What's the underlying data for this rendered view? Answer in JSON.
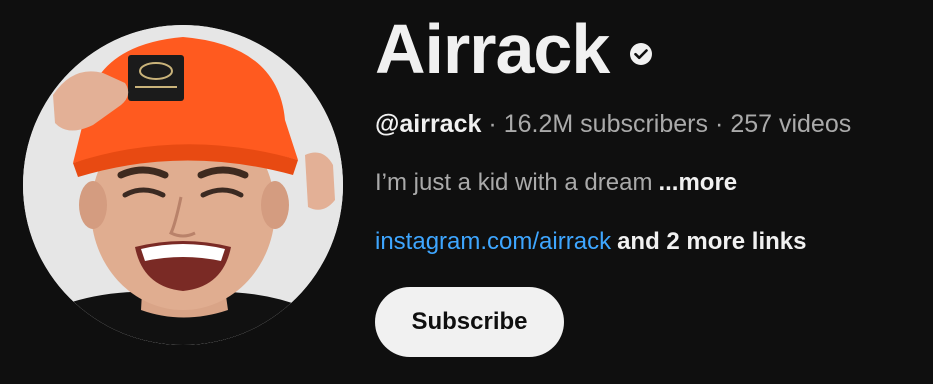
{
  "channel": {
    "name": "Airrack",
    "handle": "@airrack",
    "separator": "·",
    "subscribers": "16.2M subscribers",
    "videos": "257 videos",
    "description": "I’m just a kid with a dream",
    "description_more": "...more",
    "link": "instagram.com/airrack",
    "more_links": "and 2 more links",
    "subscribe_label": "Subscribe",
    "avatar_icon": "channel-avatar-photo",
    "verified_icon": "verified-check-icon"
  },
  "colors": {
    "background": "#0f0f0f",
    "primary_text": "#f1f1f1",
    "secondary_text": "#aaaaaa",
    "link": "#3ea6ff",
    "button_bg": "#f1f1f1",
    "button_text": "#0f0f0f",
    "hat": "#ff5a1f"
  }
}
